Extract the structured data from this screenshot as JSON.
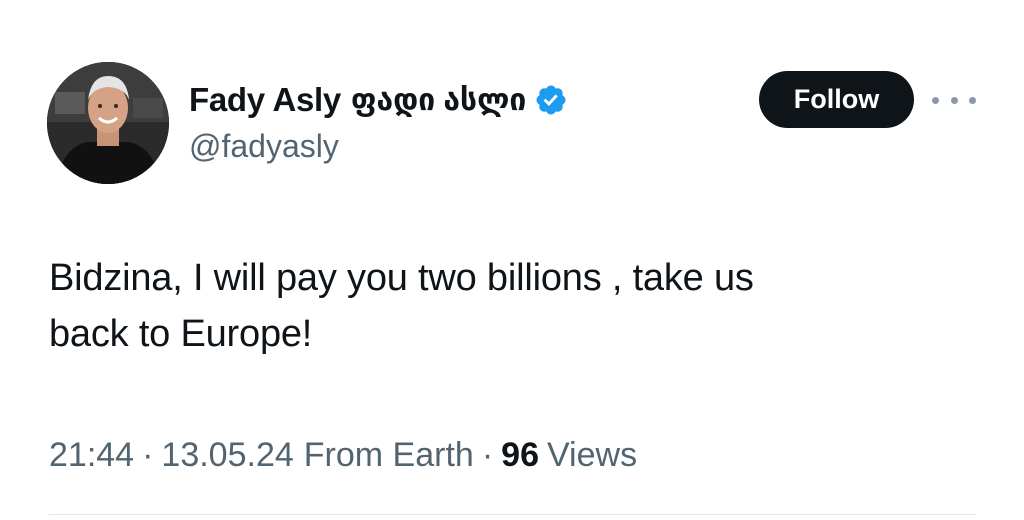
{
  "tweet": {
    "author": {
      "display_name": "Fady Asly",
      "display_name_georgian": "ფადი ასლი",
      "handle": "@fadyasly",
      "verified": true,
      "verified_badge_color": "#1d9bf0"
    },
    "follow_label": "Follow",
    "more_icon": "more-horizontal-icon",
    "text_line1": "Bidzina, I will pay you two billions , take us",
    "text_line2": "back to Europe!",
    "meta": {
      "time": "21:44",
      "date": "13.05.24",
      "source": "From Earth",
      "separator": "·",
      "views_count": "96",
      "views_label": "Views"
    }
  },
  "colors": {
    "text_primary": "#0f1419",
    "text_secondary": "#536471",
    "follow_button_bg": "#0f1419",
    "follow_button_text": "#ffffff"
  }
}
